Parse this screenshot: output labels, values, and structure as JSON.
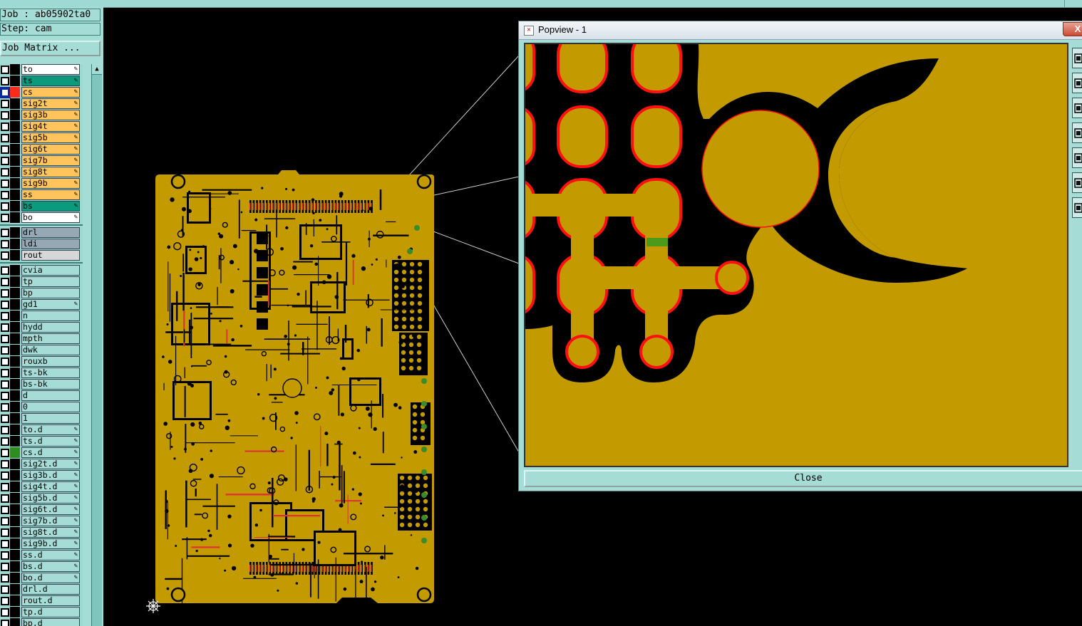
{
  "job": {
    "label": "Job : ab05902ta0",
    "step": "Step: cam",
    "matrix_button": "Job Matrix ..."
  },
  "layers_board": [
    {
      "name": "to",
      "color": "#ffffff",
      "sw": "#000000",
      "edit": true
    },
    {
      "name": "ts",
      "color": "#0c9a7c",
      "sw": "#000000",
      "edit": true
    },
    {
      "name": "cs",
      "color": "#ffc45c",
      "sw": "#ff2b1a",
      "edit": true,
      "active": true
    },
    {
      "name": "sig2t",
      "color": "#ffc45c",
      "sw": "#000000",
      "edit": true
    },
    {
      "name": "sig3b",
      "color": "#ffc45c",
      "sw": "#000000",
      "edit": true
    },
    {
      "name": "sig4t",
      "color": "#ffc45c",
      "sw": "#000000",
      "edit": true
    },
    {
      "name": "sig5b",
      "color": "#ffc45c",
      "sw": "#000000",
      "edit": true
    },
    {
      "name": "sig6t",
      "color": "#ffc45c",
      "sw": "#000000",
      "edit": true
    },
    {
      "name": "sig7b",
      "color": "#ffc45c",
      "sw": "#000000",
      "edit": true
    },
    {
      "name": "sig8t",
      "color": "#ffc45c",
      "sw": "#000000",
      "edit": true
    },
    {
      "name": "sig9b",
      "color": "#ffc45c",
      "sw": "#000000",
      "edit": true
    },
    {
      "name": "ss",
      "color": "#ffc45c",
      "sw": "#000000",
      "edit": true
    },
    {
      "name": "bs",
      "color": "#0c9a7c",
      "sw": "#000000",
      "edit": true
    },
    {
      "name": "bo",
      "color": "#ffffff",
      "sw": "#000000",
      "edit": true
    }
  ],
  "layers_drill": [
    {
      "name": "drl",
      "color": "#95a8b4",
      "sw": "#000000",
      "edit": false
    },
    {
      "name": "ldi",
      "color": "#95a8b4",
      "sw": "#000000",
      "edit": false
    },
    {
      "name": "rout",
      "color": "#d7d7d7",
      "sw": "#000000",
      "edit": false
    }
  ],
  "layers_misc": [
    {
      "name": "cvia",
      "edit": false
    },
    {
      "name": "tp",
      "edit": false
    },
    {
      "name": "bp",
      "edit": false
    },
    {
      "name": "gd1",
      "edit": true
    },
    {
      "name": "n",
      "edit": false
    },
    {
      "name": "hydd",
      "edit": false
    },
    {
      "name": "mpth",
      "edit": false
    },
    {
      "name": "dwk",
      "edit": false
    },
    {
      "name": "rouxb",
      "edit": false
    },
    {
      "name": "ts-bk",
      "edit": false
    },
    {
      "name": "bs-bk",
      "edit": false
    },
    {
      "name": "d",
      "edit": false
    },
    {
      "name": "0",
      "edit": false
    },
    {
      "name": "1",
      "edit": false
    },
    {
      "name": "to.d",
      "edit": true
    },
    {
      "name": "ts.d",
      "edit": true
    },
    {
      "name": "cs.d",
      "edit": true,
      "sw": "#2f8c1e"
    },
    {
      "name": "sig2t.d",
      "edit": true
    },
    {
      "name": "sig3b.d",
      "edit": true
    },
    {
      "name": "sig4t.d",
      "edit": true
    },
    {
      "name": "sig5b.d",
      "edit": true
    },
    {
      "name": "sig6t.d",
      "edit": true
    },
    {
      "name": "sig7b.d",
      "edit": true
    },
    {
      "name": "sig8t.d",
      "edit": true
    },
    {
      "name": "sig9b.d",
      "edit": true
    },
    {
      "name": "ss.d",
      "edit": true
    },
    {
      "name": "bs.d",
      "edit": true
    },
    {
      "name": "bo.d",
      "edit": true
    },
    {
      "name": "drl.d",
      "edit": false
    },
    {
      "name": "rout.d",
      "edit": false
    },
    {
      "name": "tp.d",
      "edit": false
    },
    {
      "name": "bp.d",
      "edit": false
    }
  ],
  "popview": {
    "title": "Popview - 1",
    "close_x": "X",
    "close_button": "Close"
  },
  "colors": {
    "copper": "#c39a00",
    "pad_outline": "#ff1010",
    "background": "#000000",
    "panel": "#a6dcd6",
    "highlight": "#4c9a1a"
  },
  "icons": [
    "pencil-icon",
    "checkbox-icon",
    "snowflake-origin-icon",
    "app-icon",
    "zoom-tool-icon"
  ]
}
